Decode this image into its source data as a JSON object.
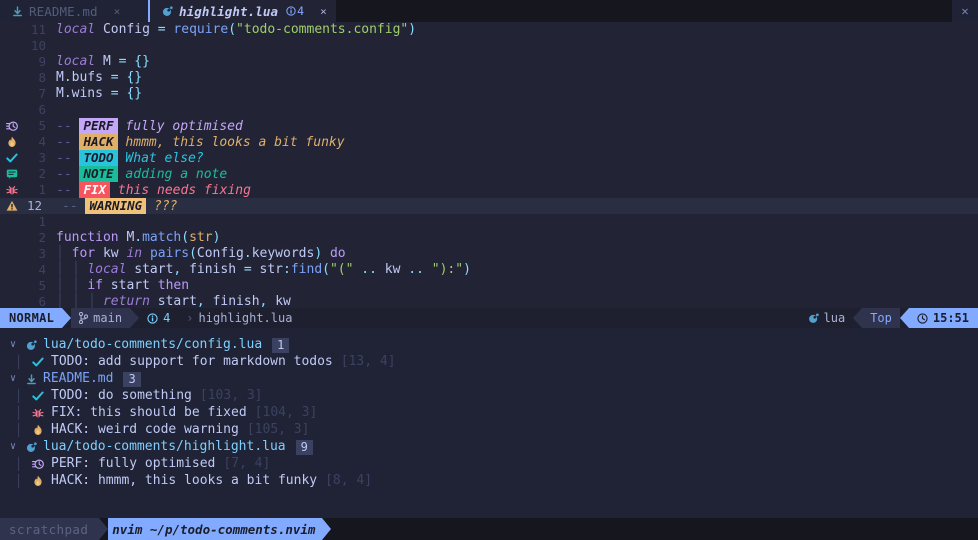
{
  "tabline": {
    "tabs": [
      {
        "name": "README.md",
        "icon": "markdown-icon",
        "active": false,
        "close": "×"
      },
      {
        "name": "highlight.lua",
        "icon": "lua-icon",
        "active": true,
        "close": "×",
        "diag_icon": "info-icon",
        "diag_count": "4"
      }
    ],
    "close_button": "✕"
  },
  "editor": {
    "lines": [
      {
        "sign": "",
        "num": "11",
        "current": false,
        "tokens": [
          {
            "t": "local",
            "c": "kw"
          },
          {
            "t": " ",
            "c": "plain"
          },
          {
            "t": "Config",
            "c": "ident"
          },
          {
            "t": " ",
            "c": "plain"
          },
          {
            "t": "=",
            "c": "op"
          },
          {
            "t": " ",
            "c": "plain"
          },
          {
            "t": "require",
            "c": "fn"
          },
          {
            "t": "(",
            "c": "punct"
          },
          {
            "t": "\"todo-comments.config\"",
            "c": "str"
          },
          {
            "t": ")",
            "c": "punct"
          }
        ]
      },
      {
        "sign": "",
        "num": "10",
        "current": false,
        "tokens": []
      },
      {
        "sign": "",
        "num": "9",
        "current": false,
        "tokens": [
          {
            "t": "local",
            "c": "kw"
          },
          {
            "t": " ",
            "c": "plain"
          },
          {
            "t": "M",
            "c": "ident"
          },
          {
            "t": " ",
            "c": "plain"
          },
          {
            "t": "=",
            "c": "op"
          },
          {
            "t": " ",
            "c": "plain"
          },
          {
            "t": "{}",
            "c": "punct"
          }
        ]
      },
      {
        "sign": "",
        "num": "8",
        "current": false,
        "tokens": [
          {
            "t": "M",
            "c": "ident"
          },
          {
            "t": ".",
            "c": "punct"
          },
          {
            "t": "bufs",
            "c": "ident"
          },
          {
            "t": " ",
            "c": "plain"
          },
          {
            "t": "=",
            "c": "op"
          },
          {
            "t": " ",
            "c": "plain"
          },
          {
            "t": "{}",
            "c": "punct"
          }
        ]
      },
      {
        "sign": "",
        "num": "7",
        "current": false,
        "tokens": [
          {
            "t": "M",
            "c": "ident"
          },
          {
            "t": ".",
            "c": "punct"
          },
          {
            "t": "wins",
            "c": "ident"
          },
          {
            "t": " ",
            "c": "plain"
          },
          {
            "t": "=",
            "c": "op"
          },
          {
            "t": " ",
            "c": "plain"
          },
          {
            "t": "{}",
            "c": "punct"
          }
        ]
      },
      {
        "sign": "",
        "num": "6",
        "current": false,
        "tokens": []
      },
      {
        "sign": "perf-icon",
        "num": "5",
        "current": false,
        "kind": "todo",
        "dashes": "-- ",
        "chip": "PERF",
        "chip_class": "chip-perf",
        "text": "fully optimised",
        "text_class": "ct-perf"
      },
      {
        "sign": "hack-icon",
        "num": "4",
        "current": false,
        "kind": "todo",
        "dashes": "-- ",
        "chip": "HACK",
        "chip_class": "chip-hack",
        "text": "hmmm, this looks a bit funky",
        "text_class": "ct-hack"
      },
      {
        "sign": "todo-icon",
        "num": "3",
        "current": false,
        "kind": "todo",
        "dashes": "-- ",
        "chip": "TODO",
        "chip_class": "chip-todo",
        "text": "What else?",
        "text_class": "ct-todo"
      },
      {
        "sign": "note-icon",
        "num": "2",
        "current": false,
        "kind": "todo",
        "dashes": "-- ",
        "chip": "NOTE",
        "chip_class": "chip-note",
        "text": "adding a note",
        "text_class": "ct-note"
      },
      {
        "sign": "fix-icon",
        "num": "1",
        "current": false,
        "kind": "todo",
        "dashes": "-- ",
        "chip": "FIX",
        "chip_class": "chip-fix",
        "text": "this needs fixing",
        "text_class": "ct-fix"
      },
      {
        "sign": "warning-icon",
        "num": "12",
        "current": true,
        "kind": "todo",
        "dashes": "-- ",
        "chip": "WARNING",
        "chip_class": "chip-warn",
        "text": "???",
        "text_class": "ct-warn"
      },
      {
        "sign": "",
        "num": "1",
        "current": false,
        "tokens": []
      },
      {
        "sign": "",
        "num": "2",
        "current": false,
        "tokens": [
          {
            "t": "function",
            "c": "kw2"
          },
          {
            "t": " ",
            "c": "plain"
          },
          {
            "t": "M",
            "c": "ident"
          },
          {
            "t": ".",
            "c": "punct"
          },
          {
            "t": "match",
            "c": "fn"
          },
          {
            "t": "(",
            "c": "punct"
          },
          {
            "t": "str",
            "c": "param"
          },
          {
            "t": ")",
            "c": "punct"
          }
        ]
      },
      {
        "sign": "",
        "num": "3",
        "current": false,
        "tokens": [
          {
            "t": "  ",
            "c": "plain"
          },
          {
            "t": "for",
            "c": "kw2"
          },
          {
            "t": " ",
            "c": "plain"
          },
          {
            "t": "kw",
            "c": "ident"
          },
          {
            "t": " ",
            "c": "plain"
          },
          {
            "t": "in",
            "c": "kw"
          },
          {
            "t": " ",
            "c": "plain"
          },
          {
            "t": "pairs",
            "c": "fn"
          },
          {
            "t": "(",
            "c": "punct"
          },
          {
            "t": "Config",
            "c": "ident"
          },
          {
            "t": ".",
            "c": "punct"
          },
          {
            "t": "keywords",
            "c": "ident"
          },
          {
            "t": ")",
            "c": "punct"
          },
          {
            "t": " ",
            "c": "plain"
          },
          {
            "t": "do",
            "c": "kw2"
          }
        ],
        "indent": 1
      },
      {
        "sign": "",
        "num": "4",
        "current": false,
        "tokens": [
          {
            "t": "    ",
            "c": "plain"
          },
          {
            "t": "local",
            "c": "kw"
          },
          {
            "t": " ",
            "c": "plain"
          },
          {
            "t": "start",
            "c": "ident"
          },
          {
            "t": ",",
            "c": "punct"
          },
          {
            "t": " ",
            "c": "plain"
          },
          {
            "t": "finish",
            "c": "ident"
          },
          {
            "t": " ",
            "c": "plain"
          },
          {
            "t": "=",
            "c": "op"
          },
          {
            "t": " ",
            "c": "plain"
          },
          {
            "t": "str",
            "c": "ident"
          },
          {
            "t": ":",
            "c": "punct"
          },
          {
            "t": "find",
            "c": "fn"
          },
          {
            "t": "(",
            "c": "punct"
          },
          {
            "t": "\"(\"",
            "c": "str"
          },
          {
            "t": " ",
            "c": "plain"
          },
          {
            "t": "..",
            "c": "op"
          },
          {
            "t": " ",
            "c": "plain"
          },
          {
            "t": "kw",
            "c": "ident"
          },
          {
            "t": " ",
            "c": "plain"
          },
          {
            "t": "..",
            "c": "op"
          },
          {
            "t": " ",
            "c": "plain"
          },
          {
            "t": "\"):\"",
            "c": "str"
          },
          {
            "t": ")",
            "c": "punct"
          }
        ],
        "indent": 2
      },
      {
        "sign": "",
        "num": "5",
        "current": false,
        "tokens": [
          {
            "t": "    ",
            "c": "plain"
          },
          {
            "t": "if",
            "c": "kw2"
          },
          {
            "t": " ",
            "c": "plain"
          },
          {
            "t": "start",
            "c": "ident"
          },
          {
            "t": " ",
            "c": "plain"
          },
          {
            "t": "then",
            "c": "kw2"
          }
        ],
        "indent": 2
      },
      {
        "sign": "",
        "num": "6",
        "current": false,
        "tokens": [
          {
            "t": "      ",
            "c": "plain"
          },
          {
            "t": "return",
            "c": "kw"
          },
          {
            "t": " ",
            "c": "plain"
          },
          {
            "t": "start",
            "c": "ident"
          },
          {
            "t": ",",
            "c": "punct"
          },
          {
            "t": " ",
            "c": "plain"
          },
          {
            "t": "finish",
            "c": "ident"
          },
          {
            "t": ",",
            "c": "punct"
          },
          {
            "t": " ",
            "c": "plain"
          },
          {
            "t": "kw",
            "c": "ident"
          }
        ],
        "indent": 3
      }
    ]
  },
  "statusline": {
    "mode": "NORMAL",
    "branch_icon": "git-branch-icon",
    "branch": "main",
    "diag_icon": "info-icon",
    "diag_count": "4",
    "file_sep": "›",
    "filename": "highlight.lua",
    "filetype_icon": "lua-icon",
    "filetype": "lua",
    "position": "Top",
    "clock_icon": "clock-icon",
    "time": "15:51"
  },
  "trouble": {
    "groups": [
      {
        "chevron": "∨",
        "icon": "lua-icon",
        "file": "lua/todo-comments/config.lua",
        "file_class": "",
        "count": "1",
        "items": [
          {
            "icon": "todo-icon",
            "text": "TODO: add support for markdown todos",
            "pos": "[13, 4]"
          }
        ]
      },
      {
        "chevron": "∨",
        "icon": "markdown-icon",
        "file": "README.md",
        "file_class": "md",
        "count": "3",
        "items": [
          {
            "icon": "todo-icon",
            "text": "TODO: do something",
            "pos": "[103, 3]"
          },
          {
            "icon": "fix-icon",
            "text": "FIX: this should be fixed",
            "pos": "[104, 3]"
          },
          {
            "icon": "hack-icon",
            "text": "HACK: weird code warning",
            "pos": "[105, 3]"
          }
        ]
      },
      {
        "chevron": "∨",
        "icon": "lua-icon",
        "file": "lua/todo-comments/highlight.lua",
        "file_class": "",
        "count": "9",
        "items": [
          {
            "icon": "perf-icon",
            "text": "PERF: fully optimised",
            "pos": "[7, 4]"
          },
          {
            "icon": "hack-icon",
            "text": "HACK: hmmm, this looks a bit funky",
            "pos": "[8, 4]"
          }
        ]
      }
    ]
  },
  "tmux": {
    "session": "scratchpad",
    "window": "nvim ~/p/todo-comments.nvim"
  },
  "colors": {
    "bg": "#1a1b26",
    "editor_bg": "#222436",
    "panel_bg": "#1f2335",
    "accent": "#82aaff",
    "perf": "#c4a7f7",
    "hack": "#e0af68",
    "todo": "#2ac3de",
    "note": "#1abc9c",
    "fix": "#f7768e",
    "warning": "#e0af68"
  }
}
